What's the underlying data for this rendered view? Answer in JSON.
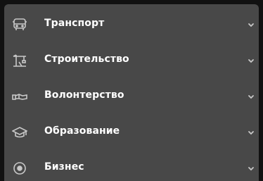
{
  "menu": {
    "items": [
      {
        "label": "Транспорт",
        "icon": "bus-icon"
      },
      {
        "label": "Строительство",
        "icon": "crane-icon"
      },
      {
        "label": "Волонтерство",
        "icon": "hands-icon"
      },
      {
        "label": "Образование",
        "icon": "graduation-cap-icon"
      },
      {
        "label": "Бизнес",
        "icon": "coin-icon"
      }
    ]
  },
  "colors": {
    "panel_bg": "#484848",
    "outer_bg": "#111111",
    "text": "#ffffff",
    "icon": "#c8c8c8"
  }
}
